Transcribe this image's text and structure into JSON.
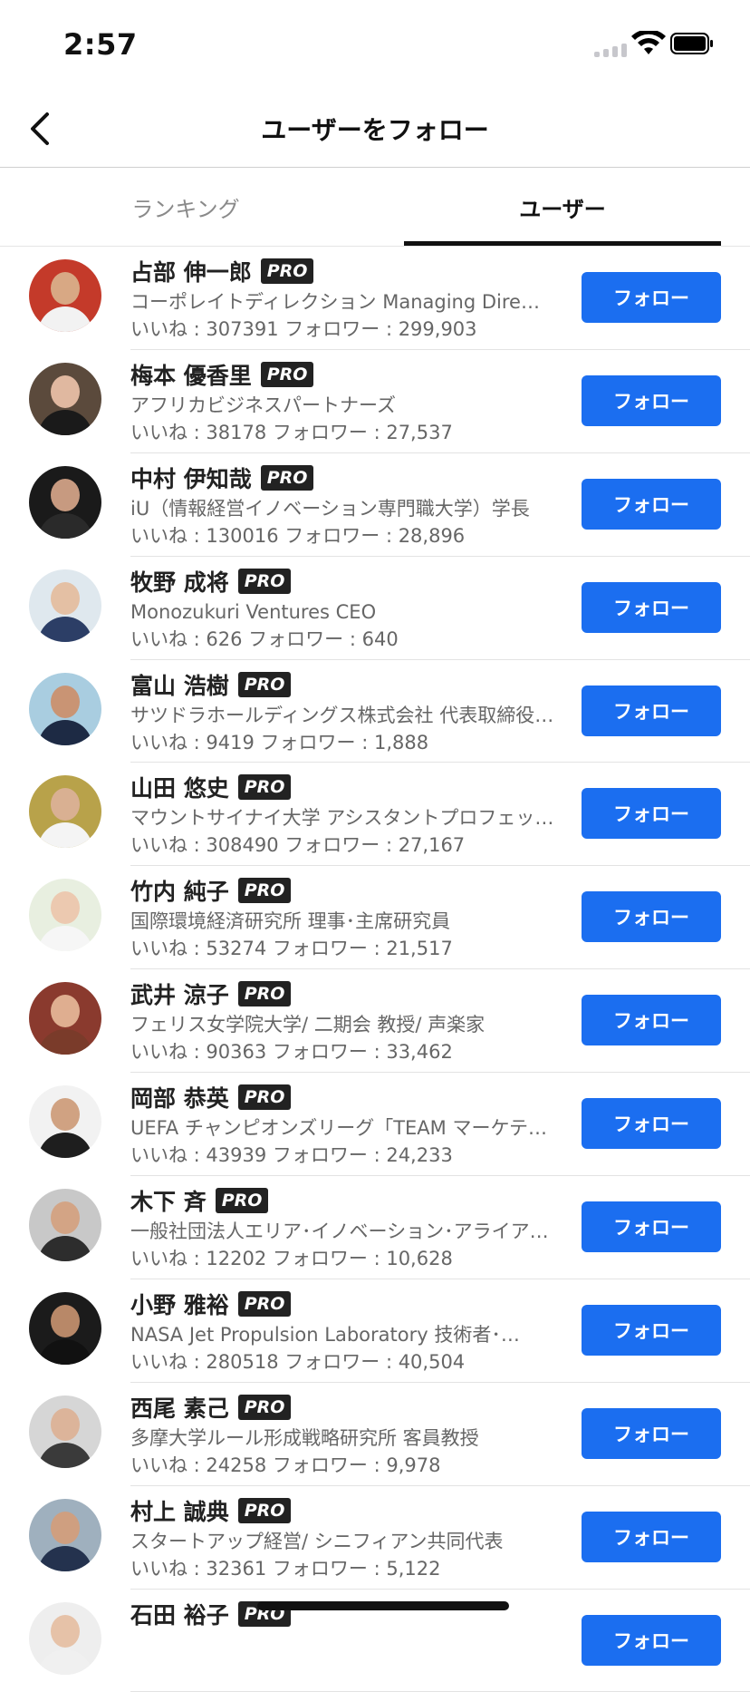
{
  "status": {
    "time": "2:57"
  },
  "nav": {
    "title": "ユーザーをフォロー"
  },
  "tabs": [
    {
      "label": "ランキング"
    },
    {
      "label": "ユーザー"
    }
  ],
  "colors": {
    "accent": "#1b6ef0",
    "badge": "#222222"
  },
  "users": [
    {
      "name": "占部 伸一郎",
      "badge": "PRO",
      "subtitle": "コーポレイトディレクション Managing Dire…",
      "stats": "いいね : 307391 フォロワー : 299,903",
      "follow_label": "フォロー",
      "skin": "#d8a884",
      "shirt": "#f2f2f2",
      "bg": "#c43a2a"
    },
    {
      "name": "梅本 優香里",
      "badge": "PRO",
      "subtitle": "アフリカビジネスパートナーズ",
      "stats": "いいね : 38178 フォロワー : 27,537",
      "follow_label": "フォロー",
      "skin": "#e0b8a0",
      "shirt": "#1a1a1a",
      "bg": "#5b4a3c"
    },
    {
      "name": "中村 伊知哉",
      "badge": "PRO",
      "subtitle": "iU（情報経営イノベーション専門職大学）学長",
      "stats": "いいね : 130016 フォロワー : 28,896",
      "follow_label": "フォロー",
      "skin": "#c79a80",
      "shirt": "#2a2a2a",
      "bg": "#1a1a1a"
    },
    {
      "name": "牧野 成将",
      "badge": "PRO",
      "subtitle": "Monozukuri Ventures CEO",
      "stats": "いいね : 626 フォロワー : 640",
      "follow_label": "フォロー",
      "skin": "#e4c0a4",
      "shirt": "#2c3e66",
      "bg": "#dfe8ee"
    },
    {
      "name": "富山 浩樹",
      "badge": "PRO",
      "subtitle": "サツドラホールディングス株式会社 代表取締役…",
      "stats": "いいね : 9419 フォロワー : 1,888",
      "follow_label": "フォロー",
      "skin": "#c99474",
      "shirt": "#1d2a44",
      "bg": "#a9cde0"
    },
    {
      "name": "山田 悠史",
      "badge": "PRO",
      "subtitle": "マウントサイナイ大学 アシスタントプロフェッ…",
      "stats": "いいね : 308490 フォロワー : 27,167",
      "follow_label": "フォロー",
      "skin": "#d9b092",
      "shirt": "#f4f4f4",
      "bg": "#b8a24a"
    },
    {
      "name": "竹内 純子",
      "badge": "PRO",
      "subtitle": "国際環境経済研究所 理事･主席研究員",
      "stats": "いいね : 53274 フォロワー : 21,517",
      "follow_label": "フォロー",
      "skin": "#ecc9b0",
      "shirt": "#f6f6f6",
      "bg": "#e8efe0"
    },
    {
      "name": "武井 涼子",
      "badge": "PRO",
      "subtitle": "フェリス女学院大学/ 二期会 教授/ 声楽家",
      "stats": "いいね : 90363 フォロワー : 33,462",
      "follow_label": "フォロー",
      "skin": "#dfae90",
      "shirt": "#7a3b2a",
      "bg": "#8a3a2e"
    },
    {
      "name": "岡部 恭英",
      "badge": "PRO",
      "subtitle": "UEFA チャンピオンズリーグ「TEAM マーケテ…",
      "stats": "いいね : 43939 フォロワー : 24,233",
      "follow_label": "フォロー",
      "skin": "#d0a282",
      "shirt": "#1e1e1e",
      "bg": "#f2f2f2"
    },
    {
      "name": "木下 斉",
      "badge": "PRO",
      "subtitle": "一般社団法人エリア･イノベーション･アライア…",
      "stats": "いいね : 12202 フォロワー : 10,628",
      "follow_label": "フォロー",
      "skin": "#d3a485",
      "shirt": "#2d2d2d",
      "bg": "#c8c8c8"
    },
    {
      "name": "小野 雅裕",
      "badge": "PRO",
      "subtitle": "NASA Jet Propulsion Laboratory 技術者･…",
      "stats": "いいね : 280518 フォロワー : 40,504",
      "follow_label": "フォロー",
      "skin": "#b88868",
      "shirt": "#111111",
      "bg": "#1b1b1b"
    },
    {
      "name": "西尾 素己",
      "badge": "PRO",
      "subtitle": "多摩大学ルール形成戦略研究所 客員教授",
      "stats": "いいね : 24258 フォロワー : 9,978",
      "follow_label": "フォロー",
      "skin": "#dcb49a",
      "shirt": "#3a3a3a",
      "bg": "#d6d6d6"
    },
    {
      "name": "村上 誠典",
      "badge": "PRO",
      "subtitle": "スタートアップ経営/ シニフィアン共同代表",
      "stats": "いいね : 32361 フォロワー : 5,122",
      "follow_label": "フォロー",
      "skin": "#cf9f80",
      "shirt": "#24324e",
      "bg": "#9fb0be"
    },
    {
      "name": "石田 裕子",
      "badge": "PRO",
      "subtitle": "",
      "stats": "",
      "follow_label": "フォロー",
      "skin": "#e6c2a8",
      "shirt": "#f0f0f0",
      "bg": "#eeeeee"
    }
  ]
}
